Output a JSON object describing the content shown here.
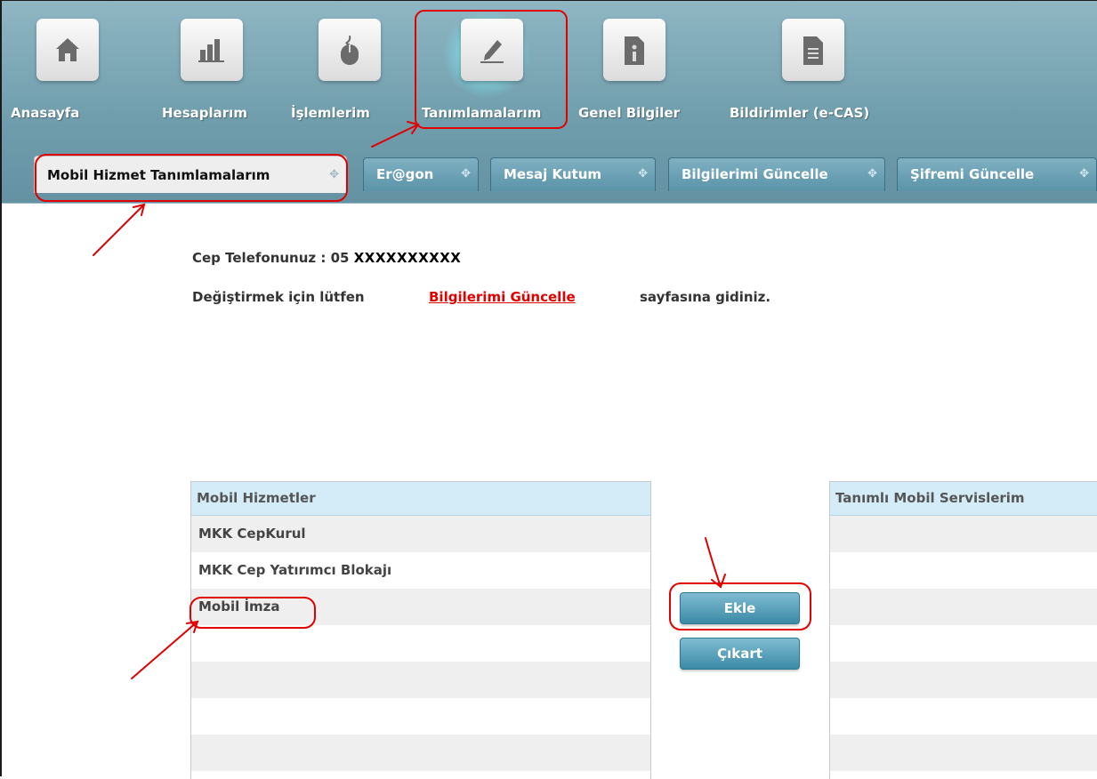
{
  "nav": {
    "items": [
      {
        "label": "Anasayfa",
        "icon": "home-icon"
      },
      {
        "label": "Hesaplarım",
        "icon": "chart-icon"
      },
      {
        "label": "İşlemlerim",
        "icon": "mouse-icon"
      },
      {
        "label": "Tanımlamalarım",
        "icon": "pencil-icon"
      },
      {
        "label": "Genel Bilgiler",
        "icon": "info-icon"
      },
      {
        "label": "Bildirimler (e-CAS)",
        "icon": "document-icon"
      }
    ]
  },
  "tabs": [
    {
      "label": "Mobil Hizmet Tanımlamalarım",
      "active": true
    },
    {
      "label": "Er@gon"
    },
    {
      "label": "Mesaj Kutum"
    },
    {
      "label": "Bilgilerimi Güncelle"
    },
    {
      "label": "Şifremi Güncelle"
    }
  ],
  "tab_move_glyph": "✥",
  "info": {
    "phone_label": "Cep Telefonunuz : 05",
    "phone_value": "XXXXXXXXXX",
    "change_prefix": "Değiştirmek için lütfen",
    "change_link": "Bilgilerimi Güncelle",
    "change_suffix": "sayfasına gidiniz."
  },
  "services": {
    "header": "Mobil Hizmetler",
    "items": [
      "MKK CepKurul",
      "MKK Cep Yatırımcı Blokajı",
      "Mobil İmza"
    ]
  },
  "defined": {
    "header": "Tanımlı Mobil Servislerim",
    "items": []
  },
  "buttons": {
    "add": "Ekle",
    "remove": "Çıkart"
  },
  "colors": {
    "nav_bg": "#7aa6b5",
    "tab_bg": "#5b93a8",
    "header_bg": "#d4ecf8",
    "link": "#e00000",
    "annotation": "#e00000"
  }
}
